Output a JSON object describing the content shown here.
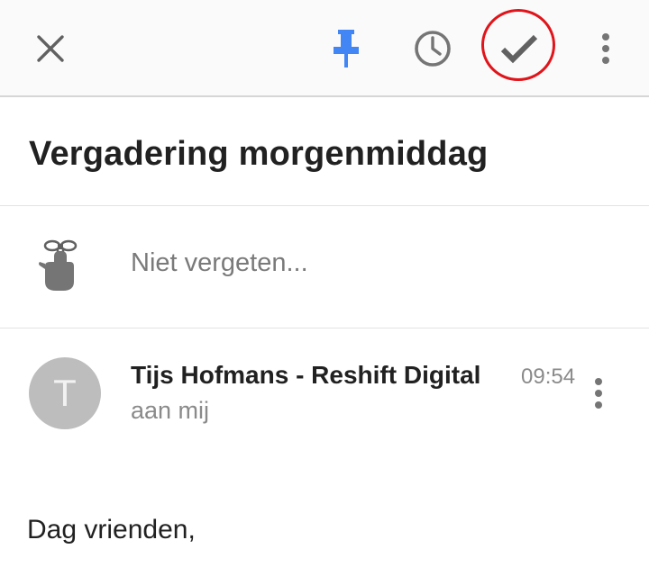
{
  "toolbar": {
    "icons": {
      "close": "close-icon",
      "pin": "pin-icon",
      "snooze": "clock-icon",
      "done": "checkmark-icon",
      "more": "more-vertical-icon"
    },
    "colors": {
      "pin": "#4285f4",
      "icon": "#757575",
      "highlight_ring": "#e0141a"
    }
  },
  "message": {
    "subject": "Vergadering morgenmiddag",
    "reminder_placeholder": "Niet vergeten...",
    "reminder_icon": "finger-string-reminder-icon",
    "sender": {
      "avatar_letter": "T",
      "name": "Tijs Hofmans - Reshift Digital",
      "recipient": "aan mij",
      "time": "09:54"
    },
    "body_greeting": "Dag vrienden,"
  }
}
